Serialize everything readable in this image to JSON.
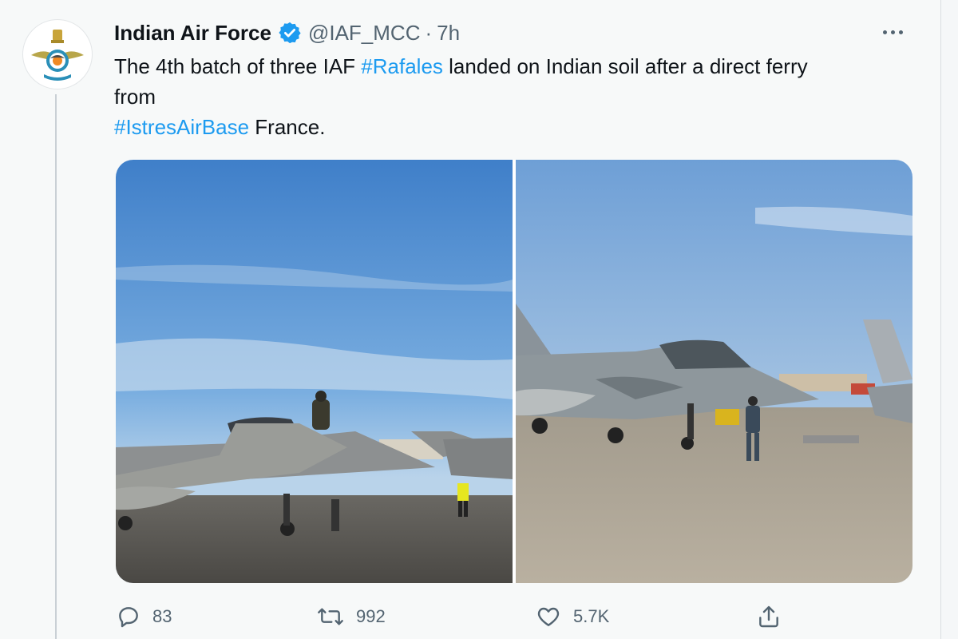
{
  "tweet": {
    "author_name": "Indian Air Force",
    "handle": "@IAF_MCC",
    "separator": "·",
    "time": "7h",
    "text_line1_pre": "The 4th batch of three IAF ",
    "hashtag1": "#Rafales",
    "text_line1_post": " landed on Indian soil after a direct ferry",
    "text_line2": "from",
    "hashtag2": "#IstresAirBase",
    "text_line3_post": " France.",
    "replies": "83",
    "retweets": "992",
    "likes": "5.7K"
  },
  "colors": {
    "hashtag": "#1d9bf0",
    "verified": "#1d9bf0",
    "secondary_text": "#536471"
  },
  "icons": {
    "verified": "verified-badge-icon",
    "more": "more-options-icon",
    "reply": "reply-icon",
    "retweet": "retweet-icon",
    "like": "heart-icon",
    "share": "share-icon",
    "avatar": "iaf-emblem-logo"
  }
}
